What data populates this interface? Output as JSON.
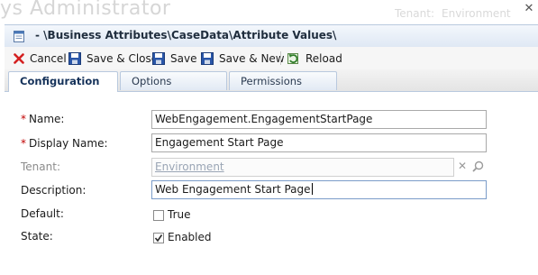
{
  "background": {
    "app_title": "ys Administrator",
    "tenant_label": "Tenant:",
    "tenant_value": "Environment"
  },
  "dialog": {
    "breadcrumb": "- \\Business Attributes\\CaseData\\Attribute Values\\"
  },
  "toolbar": {
    "cancel_label": "Cancel",
    "save_close_label": "Save & Close",
    "save_label": "Save",
    "save_new_label": "Save & New",
    "reload_label": "Reload"
  },
  "tabs": [
    {
      "label": "Configuration",
      "active": true
    },
    {
      "label": "Options",
      "active": false
    },
    {
      "label": "Permissions",
      "active": false
    }
  ],
  "form": {
    "name_label": "Name:",
    "name_value": "WebEngagement.EngagementStartPage",
    "display_name_label": "Display Name:",
    "display_name_value": "Engagement Start Page",
    "tenant_label": "Tenant:",
    "tenant_value": "Environment",
    "description_label": "Description:",
    "description_value": "Web Engagement Start Page",
    "default_label": "Default:",
    "default_checkbox_label": "True",
    "default_checked": false,
    "state_label": "State:",
    "state_checkbox_label": "Enabled",
    "state_checked": true,
    "required_marker": "*"
  },
  "colors": {
    "required": "#c00000",
    "tab_border": "#b9c9de",
    "accent": "#15325a"
  }
}
